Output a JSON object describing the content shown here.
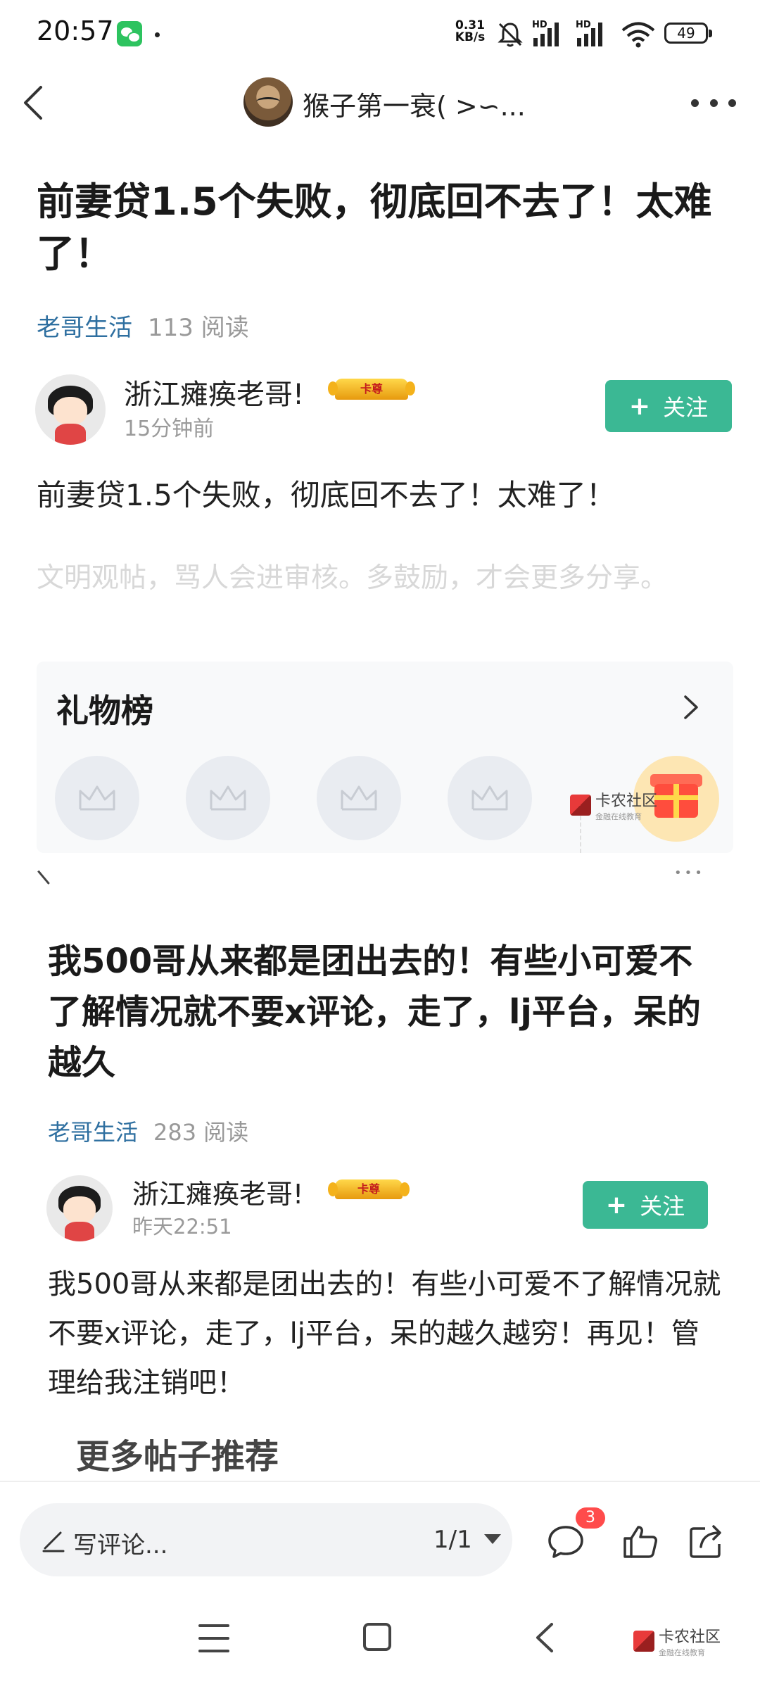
{
  "status_bar": {
    "time": "20:57",
    "net_speed_value": "0.31",
    "net_speed_unit": "KB/s",
    "hd1": "HD",
    "hd2": "HD",
    "battery": "49"
  },
  "header": {
    "author_name": "猴子第一衰( >∽..."
  },
  "post1": {
    "title": "前妻贷1.5个失败，彻底回不去了！太难了！",
    "category": "老哥生活",
    "reads": "113 阅读",
    "author": "浙江瘫痪老哥!",
    "badge": "卡尊",
    "time": "15分钟前",
    "follow_label": "关注",
    "body": "前妻贷1.5个失败，彻底回不去了！太难了！",
    "tip": "文明观帖，骂人会进审核。多鼓励，才会更多分享。"
  },
  "gift_board": {
    "title": "礼物榜"
  },
  "watermark": {
    "name": "卡农社区",
    "sub": "金融在线教育"
  },
  "post2": {
    "title": "我500哥从来都是团出去的！有些小可爱不了解情况就不要x评论，走了，lj平台，呆的越久",
    "category": "老哥生活",
    "reads": "283 阅读",
    "author": "浙江瘫痪老哥!",
    "badge": "卡尊",
    "time": "昨天22:51",
    "follow_label": "关注",
    "body": "我500哥从来都是团出去的！有些小可爱不了解情况就不要x评论，走了，lj平台，呆的越久越穷！再见！管理给我注销吧！"
  },
  "more_posts": "更多帖子推荐",
  "action_bar": {
    "comment_placeholder": "写评论...",
    "pager": "1/1",
    "comment_count": "3"
  },
  "icons": {
    "back": "chevron-left-icon",
    "more": "more-dots-icon",
    "crown": "crown-icon",
    "gift": "gift-icon",
    "pen": "pen-icon",
    "comment": "comment-icon",
    "like": "thumbs-up-icon",
    "share": "share-icon"
  },
  "colors": {
    "accent": "#3bb894",
    "category": "#2e6fa0",
    "badge_red": "#ff4b4b"
  }
}
